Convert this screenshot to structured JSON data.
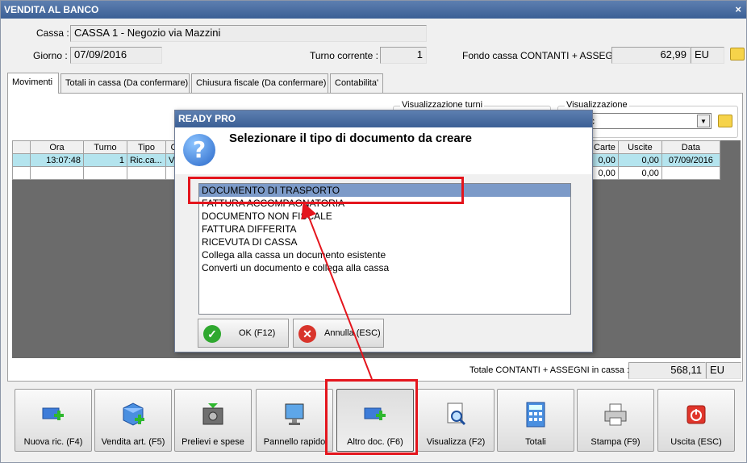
{
  "window": {
    "title": "VENDITA AL BANCO",
    "close": "×"
  },
  "header": {
    "cassa_label": "Cassa :",
    "cassa_value": "CASSA 1 - Negozio via Mazzini",
    "giorno_label": "Giorno :",
    "giorno_value": "07/09/2016",
    "turno_label": "Turno corrente :",
    "turno_value": "1",
    "fondo_label": "Fondo cassa CONTANTI + ASSEGNI :",
    "fondo_value": "62,99",
    "fondo_unit": "EU"
  },
  "tabs": [
    {
      "label": "Movimenti"
    },
    {
      "label": "Totali in cassa (Da confermare)"
    },
    {
      "label": "Chiusura fiscale (Da confermare)"
    },
    {
      "label": "Contabilita'"
    }
  ],
  "filters": {
    "turni_label": "Visualizzazione turni",
    "vis_label": "Visualizzazione",
    "vis_value": "c"
  },
  "grid": {
    "columns": [
      "Ora",
      "Turno",
      "Tipo",
      "Caus"
    ],
    "row": [
      "13:07:48",
      "1",
      "Ric.ca...",
      "VEND"
    ]
  },
  "grid_right": {
    "columns": [
      "Carte",
      "Uscite",
      "Data"
    ],
    "rows": [
      [
        "0,00",
        "0,00",
        "07/09/2016"
      ],
      [
        "0,00",
        "0,00",
        ""
      ]
    ]
  },
  "totale": {
    "label": "Totale CONTANTI + ASSEGNI in cassa :",
    "value": "568,11",
    "unit": "EU"
  },
  "buttons": [
    {
      "label": "Nuova ric. (F4)"
    },
    {
      "label": "Vendita art. (F5)"
    },
    {
      "label": "Prelievi e spese"
    },
    {
      "label": "Pannello rapido"
    },
    {
      "label": "Altro doc. (F6)"
    },
    {
      "label": "Visualizza (F2)"
    },
    {
      "label": "Totali"
    },
    {
      "label": "Stampa (F9)"
    },
    {
      "label": "Uscita (ESC)"
    }
  ],
  "dialog": {
    "title": "READY PRO",
    "message": "Selezionare il tipo di documento da creare",
    "options": [
      "DOCUMENTO DI TRASPORTO",
      "FATTURA ACCOMPAGNATORIA",
      "DOCUMENTO NON FISCALE",
      "FATTURA DIFFERITA",
      "RICEVUTA DI CASSA",
      "Collega alla cassa un documento esistente",
      "Converti un documento e collega alla cassa"
    ],
    "selected": "DOCUMENTO DI TRASPORTO",
    "ok_label": "OK (F12)",
    "cancel_label": "Annulla (ESC)"
  },
  "colors": {
    "annotation": "#e4151d",
    "titlebar": "#3b5f95",
    "selection": "#7c9ac8"
  }
}
